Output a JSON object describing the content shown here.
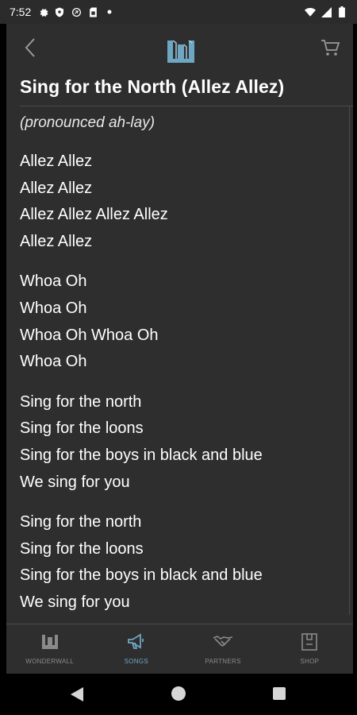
{
  "status_bar": {
    "time": "7:52",
    "left_icons": [
      "gear-icon",
      "shield-icon",
      "vpn-icon",
      "sim-icon",
      "dot-icon"
    ],
    "right_icons": [
      "wifi-icon",
      "signal-icon",
      "battery-icon"
    ]
  },
  "header": {
    "back_icon": "chevron-left-icon",
    "logo_icon": "wonderwall-logo-icon",
    "cart_icon": "cart-icon"
  },
  "song": {
    "title": "Sing for the North (Allez Allez)",
    "pronunciation": "(pronounced ah-lay)",
    "stanzas": [
      [
        "Allez Allez",
        "Allez Allez",
        "Allez Allez Allez Allez",
        "Allez Allez"
      ],
      [
        "Whoa Oh",
        "Whoa Oh",
        "Whoa Oh Whoa Oh",
        "Whoa Oh"
      ],
      [
        "Sing for the north",
        "Sing for the loons",
        "Sing for the boys in black and blue",
        "We sing for you"
      ],
      [
        "Sing for the north",
        "Sing for the loons",
        "Sing for the boys in black and blue",
        "We sing for you"
      ]
    ]
  },
  "bottom_nav": {
    "tabs": [
      {
        "label": "WONDERWALL",
        "icon": "wonderwall-icon",
        "active": false
      },
      {
        "label": "SONGS",
        "icon": "megaphone-icon",
        "active": true
      },
      {
        "label": "PARTNERS",
        "icon": "handshake-icon",
        "active": false
      },
      {
        "label": "SHOP",
        "icon": "shop-icon",
        "active": false
      }
    ]
  },
  "colors": {
    "background": "#2e2e2e",
    "status_bar": "#2b2b2b",
    "accent": "#6ea7c4",
    "inactive": "#8a8a8a",
    "divider": "#4a4a4a"
  }
}
